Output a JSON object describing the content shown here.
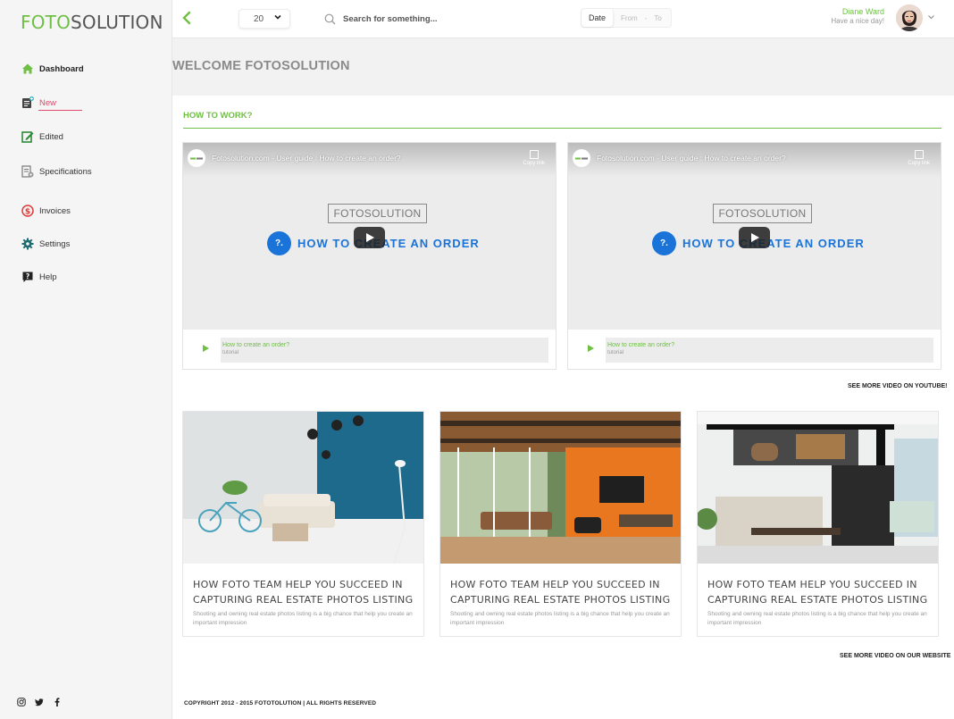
{
  "logo": {
    "part1": "FOTO",
    "part2": "SOLUTION"
  },
  "sidebar": {
    "items": [
      {
        "label": "Dashboard",
        "icon": "home-icon"
      },
      {
        "label": "New",
        "icon": "new-order-icon"
      },
      {
        "label": "Edited",
        "icon": "edit-icon"
      },
      {
        "label": "Specifications",
        "icon": "specifications-icon"
      },
      {
        "label": "Invoices",
        "icon": "invoice-icon"
      },
      {
        "label": "Settings",
        "icon": "gear-icon"
      },
      {
        "label": "Help",
        "icon": "help-icon"
      }
    ],
    "socials": [
      "instagram-icon",
      "twitter-icon",
      "facebook-icon"
    ]
  },
  "topbar": {
    "per_page": "20",
    "search_placeholder": "Search for something...",
    "date_label": "Date",
    "date_from": "From",
    "date_sep": "-",
    "date_to": "To",
    "user_name": "Diane Ward",
    "user_greeting": "Have a nice day!"
  },
  "welcome": "WELCOME FOTOSOLUTION",
  "how_to": {
    "title": "HOW TO WORK?",
    "videos": [
      {
        "title": "Fotosolution.com - User guide : How to create an order?",
        "copy_link": "Copy link",
        "brand": "FOTOSOLUTION",
        "badge": "?.",
        "headline": "HOW TO CREATE AN ORDER",
        "item_title": "How to create an order?",
        "item_tag": "tutorial"
      },
      {
        "title": "Fotosolution.com - User guide : How to create an order?",
        "copy_link": "Copy link",
        "brand": "FOTOSOLUTION",
        "badge": "?.",
        "headline": "HOW TO CREATE AN ORDER",
        "item_title": "How to create an order?",
        "item_tag": "tutorial"
      }
    ],
    "see_more_youtube": "SEE MORE VIDEO ON YOUTUBE!"
  },
  "blog": {
    "posts": [
      {
        "title": "HOW FOTO TEAM HELP YOU SUCCEED IN CAPTURING REAL ESTATE PHOTOS LISTING",
        "desc": "Shooting and owning real estate photos listing is a big chance that help you create an important impression"
      },
      {
        "title": "HOW FOTO TEAM HELP YOU SUCCEED IN CAPTURING REAL ESTATE PHOTOS LISTING",
        "desc": "Shooting and owning real estate photos listing is a big chance that help you create an important impression"
      },
      {
        "title": "HOW FOTO TEAM HELP YOU SUCCEED IN CAPTURING REAL ESTATE PHOTOS LISTING",
        "desc": "Shooting and owning real estate photos listing is a big chance that help you create an important impression"
      }
    ],
    "see_more_website": "SEE MORE VIDEO ON OUR WEBSITE"
  },
  "footer": {
    "copyright": "COPYRIGHT 2012 - 2015 FOTOTOLUTION  |  ALL RIGHTS RESERVED"
  },
  "colors": {
    "accent": "#6fbf44",
    "new": "#e04a6a",
    "video_blue": "#1a73d8"
  }
}
